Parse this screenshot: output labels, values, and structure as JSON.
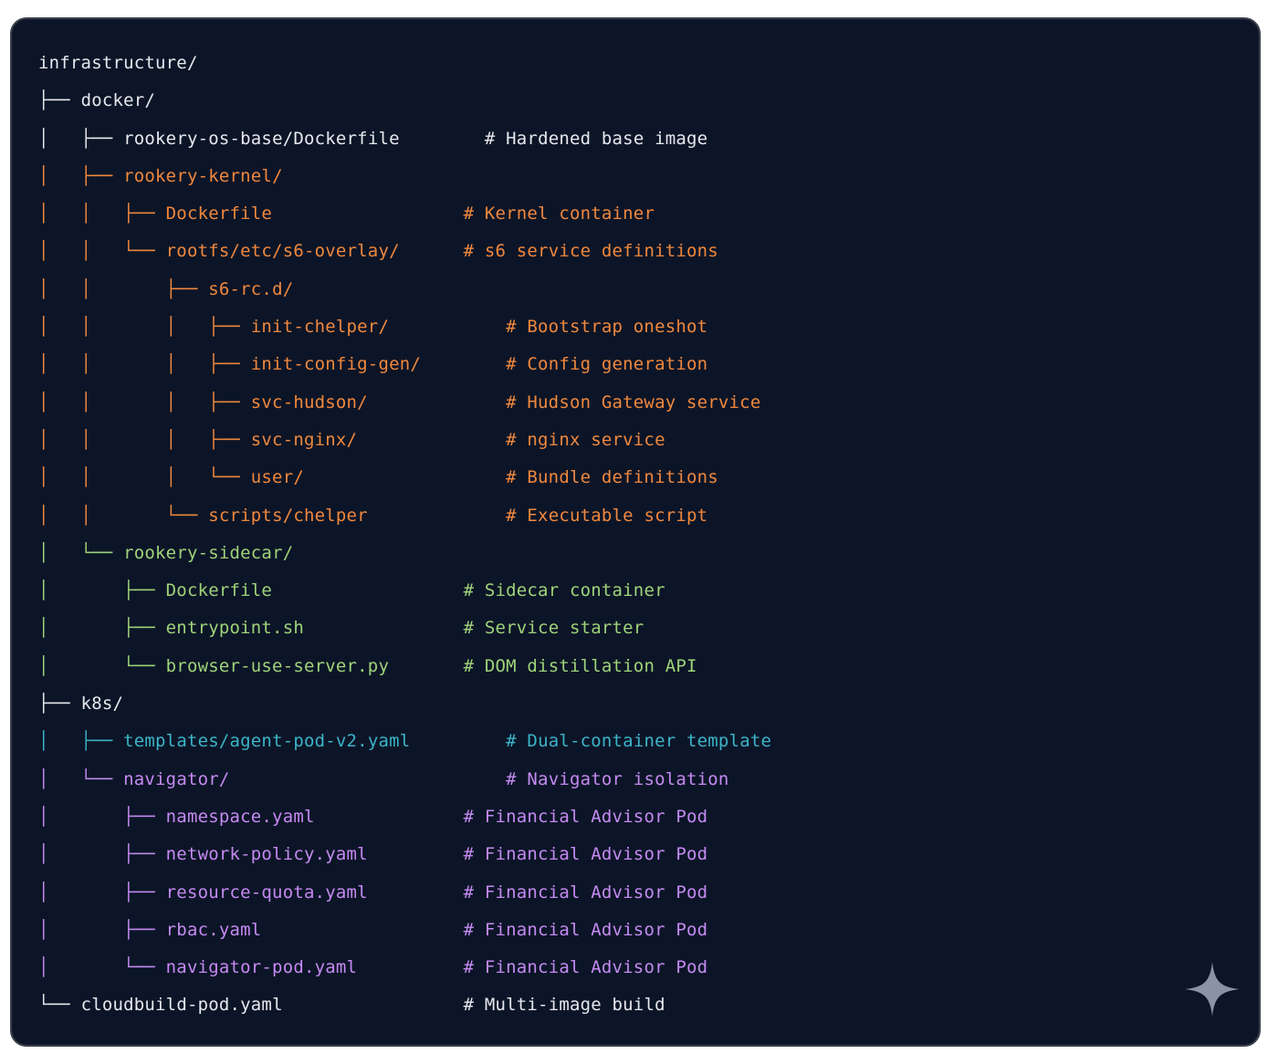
{
  "tree": {
    "lines": [
      {
        "prefix": "",
        "name": "infrastructure/",
        "comment": "",
        "prefix_color": "white",
        "name_color": "white",
        "comment_color": "white"
      },
      {
        "prefix": "├── ",
        "name": "docker/",
        "comment": "",
        "prefix_color": "white",
        "name_color": "white",
        "comment_color": "white"
      },
      {
        "prefix": "│   ├── ",
        "name": "rookery-os-base/Dockerfile",
        "comment": "# Hardened base image",
        "prefix_color": "white",
        "name_color": "white",
        "comment_color": "white",
        "pad": "        "
      },
      {
        "prefix": "│   ├── ",
        "name": "rookery-kernel/",
        "comment": "",
        "prefix_color": "orange",
        "name_color": "orange",
        "comment_color": "orange"
      },
      {
        "prefix": "│   │   ├── ",
        "name": "Dockerfile",
        "comment": "# Kernel container",
        "prefix_color": "orange",
        "name_color": "orange",
        "comment_color": "orange",
        "pad": "                  "
      },
      {
        "prefix": "│   │   └── ",
        "name": "rootfs/etc/s6-overlay/",
        "comment": "# s6 service definitions",
        "prefix_color": "orange",
        "name_color": "orange",
        "comment_color": "orange",
        "pad": "      "
      },
      {
        "prefix": "│   │       ├── ",
        "name": "s6-rc.d/",
        "comment": "",
        "prefix_color": "orange",
        "name_color": "orange",
        "comment_color": "orange"
      },
      {
        "prefix": "│   │       │   ├── ",
        "name": "init-chelper/",
        "comment": "# Bootstrap oneshot",
        "prefix_color": "orange",
        "name_color": "orange",
        "comment_color": "orange",
        "pad": "           "
      },
      {
        "prefix": "│   │       │   ├── ",
        "name": "init-config-gen/",
        "comment": "# Config generation",
        "prefix_color": "orange",
        "name_color": "orange",
        "comment_color": "orange",
        "pad": "        "
      },
      {
        "prefix": "│   │       │   ├── ",
        "name": "svc-hudson/",
        "comment": "# Hudson Gateway service",
        "prefix_color": "orange",
        "name_color": "orange",
        "comment_color": "orange",
        "pad": "             "
      },
      {
        "prefix": "│   │       │   ├── ",
        "name": "svc-nginx/",
        "comment": "# nginx service",
        "prefix_color": "orange",
        "name_color": "orange",
        "comment_color": "orange",
        "pad": "              "
      },
      {
        "prefix": "│   │       │   └── ",
        "name": "user/",
        "comment": "# Bundle definitions",
        "prefix_color": "orange",
        "name_color": "orange",
        "comment_color": "orange",
        "pad": "                   "
      },
      {
        "prefix": "│   │       └── ",
        "name": "scripts/chelper",
        "comment": "# Executable script",
        "prefix_color": "orange",
        "name_color": "orange",
        "comment_color": "orange",
        "pad": "             "
      },
      {
        "prefix": "│   └── ",
        "name": "rookery-sidecar/",
        "comment": "",
        "prefix_color": "green",
        "name_color": "green",
        "comment_color": "green"
      },
      {
        "prefix": "│       ├── ",
        "name": "Dockerfile",
        "comment": "# Sidecar container",
        "prefix_color": "green",
        "name_color": "green",
        "comment_color": "green",
        "pad": "                  "
      },
      {
        "prefix": "│       ├── ",
        "name": "entrypoint.sh",
        "comment": "# Service starter",
        "prefix_color": "green",
        "name_color": "green",
        "comment_color": "green",
        "pad": "               "
      },
      {
        "prefix": "│       └── ",
        "name": "browser-use-server.py",
        "comment": "# DOM distillation API",
        "prefix_color": "green",
        "name_color": "green",
        "comment_color": "green",
        "pad": "       "
      },
      {
        "prefix": "├── ",
        "name": "k8s/",
        "comment": "",
        "prefix_color": "white",
        "name_color": "white",
        "comment_color": "white"
      },
      {
        "prefix": "│   ├── ",
        "name": "templates/agent-pod-v2.yaml",
        "comment": "# Dual-container template",
        "prefix_color": "cyan",
        "name_color": "cyan",
        "comment_color": "cyan",
        "pad": "         "
      },
      {
        "prefix": "│   └── ",
        "name": "navigator/",
        "comment": "# Navigator isolation",
        "prefix_color": "purple",
        "name_color": "purple",
        "comment_color": "purple",
        "pad": "                          "
      },
      {
        "prefix": "│       ├── ",
        "name": "namespace.yaml",
        "comment": "# Financial Advisor Pod",
        "prefix_color": "purple",
        "name_color": "purple",
        "comment_color": "purple",
        "pad": "              "
      },
      {
        "prefix": "│       ├── ",
        "name": "network-policy.yaml",
        "comment": "# Financial Advisor Pod",
        "prefix_color": "purple",
        "name_color": "purple",
        "comment_color": "purple",
        "pad": "         "
      },
      {
        "prefix": "│       ├── ",
        "name": "resource-quota.yaml",
        "comment": "# Financial Advisor Pod",
        "prefix_color": "purple",
        "name_color": "purple",
        "comment_color": "purple",
        "pad": "         "
      },
      {
        "prefix": "│       ├── ",
        "name": "rbac.yaml",
        "comment": "# Financial Advisor Pod",
        "prefix_color": "purple",
        "name_color": "purple",
        "comment_color": "purple",
        "pad": "                   "
      },
      {
        "prefix": "│       └── ",
        "name": "navigator-pod.yaml",
        "comment": "# Financial Advisor Pod",
        "prefix_color": "purple",
        "name_color": "purple",
        "comment_color": "purple",
        "pad": "          "
      },
      {
        "prefix": "└── ",
        "name": "cloudbuild-pod.yaml",
        "comment": "# Multi-image build",
        "prefix_color": "white",
        "name_color": "white",
        "comment_color": "white",
        "pad": "                 "
      }
    ]
  },
  "colors": {
    "background": "#0c1527",
    "white": "#e6e8ee",
    "orange": "#f0883e",
    "green": "#9fd37a",
    "cyan": "#3bb4c9",
    "purple": "#c58af2",
    "sparkle": "#8a93a6"
  },
  "icons": {
    "corner": "sparkle-icon"
  }
}
